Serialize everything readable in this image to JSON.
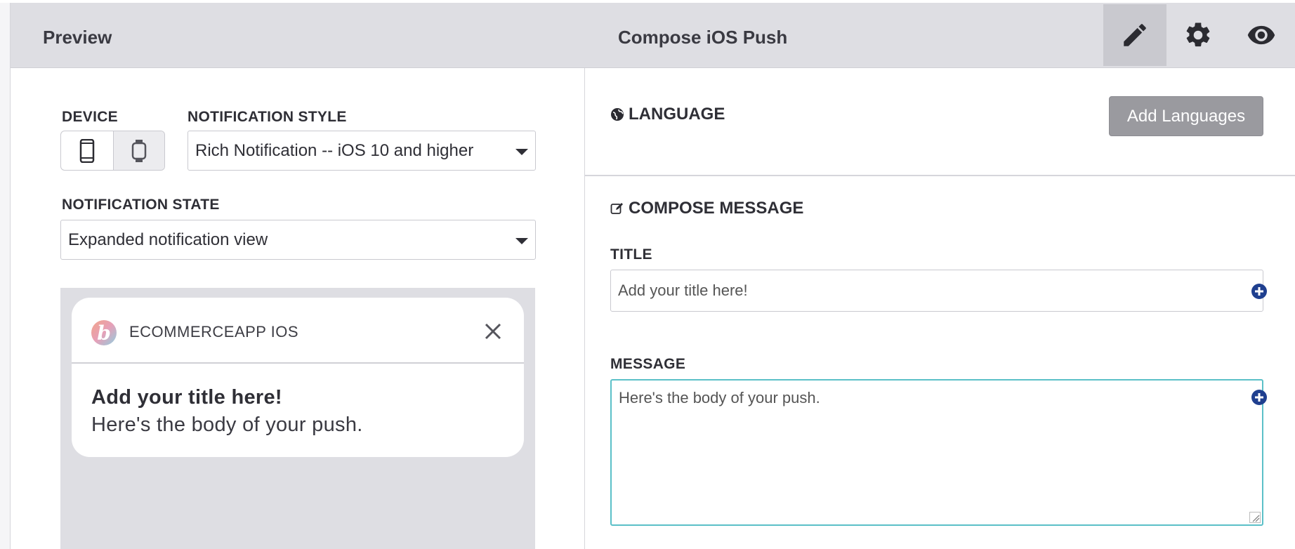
{
  "header": {
    "preview_label": "Preview",
    "title": "Compose iOS Push",
    "buttons": [
      "pencil-icon",
      "gear-icon",
      "eye-icon"
    ]
  },
  "preview_panel": {
    "device_label": "DEVICE",
    "device_options": [
      "phone-icon",
      "watch-icon"
    ],
    "notification_style_label": "NOTIFICATION STYLE",
    "notification_style_value": "Rich Notification -- iOS 10 and higher",
    "notification_state_label": "NOTIFICATION STATE",
    "notification_state_value": "Expanded notification view",
    "notification": {
      "app_icon_letter": "b",
      "app_name": "ECOMMERCEAPP IOS",
      "title": "Add your title here!",
      "body": "Here's the body of your push."
    }
  },
  "compose_panel": {
    "language_heading": "LANGUAGE",
    "add_languages_label": "Add Languages",
    "compose_heading": "COMPOSE MESSAGE",
    "title_label": "TITLE",
    "title_placeholder": "Add your title here!",
    "message_label": "MESSAGE",
    "message_value": "Here's the body of your push."
  },
  "colors": {
    "header_bg": "#dedee3",
    "accent_focus": "#5bc0c8",
    "plus_icon": "#1f3f8f",
    "add_button_bg": "#9a9a9f"
  }
}
